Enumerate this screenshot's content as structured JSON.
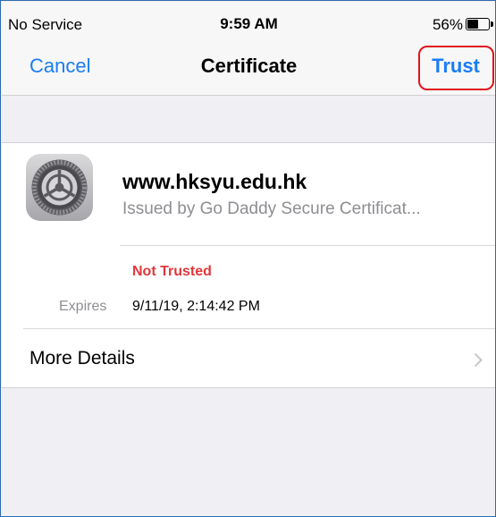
{
  "status_bar": {
    "carrier": "No Service",
    "time": "9:59 AM",
    "battery_percent": "56%",
    "battery_level": 0.56
  },
  "nav": {
    "cancel_label": "Cancel",
    "title": "Certificate",
    "trust_label": "Trust"
  },
  "certificate": {
    "icon": "settings-gear-icon",
    "domain": "www.hksyu.edu.hk",
    "issuer": "Issued by Go Daddy Secure Certificat...",
    "trust_status": "Not Trusted",
    "expires_label": "Expires",
    "expires_value": "9/11/19, 2:14:42 PM",
    "more_details_label": "More Details"
  },
  "colors": {
    "accent": "#1a7df5",
    "warning": "#e2373a",
    "highlight": "#e0141d",
    "background": "#efeff4"
  }
}
